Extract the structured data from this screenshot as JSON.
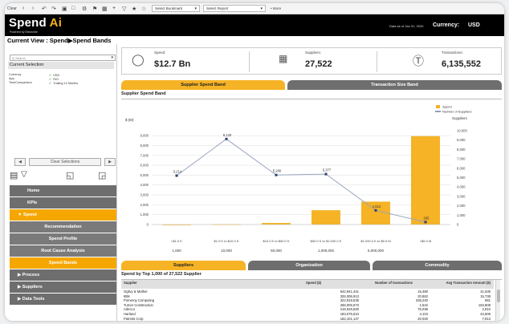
{
  "toolbar": {
    "home_label": "Clear",
    "bookmark_select": "Select Bookmark",
    "report_select": "Select Report",
    "more_label": "• More"
  },
  "header": {
    "brand_main": "Spend ",
    "brand_accent": "Ai",
    "tagline": "Powered by Electrolite",
    "data_date": "Data as of Jan 31, 2020",
    "currency_label": "Currency:",
    "currency_value": "USD"
  },
  "view_title": "Current View : Spend▶Spend Bands",
  "sidebar": {
    "search_placeholder": "Q Search",
    "current_selection_label": "Current Selection",
    "selections": [
      {
        "field": "Currency",
        "value": "USD"
      },
      {
        "field": "App",
        "value": "RIO"
      },
      {
        "field": "TimeComparison",
        "value": "Trailing 12 Months"
      }
    ],
    "clear_label": "Clear Selections",
    "prev_label": "◀",
    "next_label": "▶",
    "nav": [
      {
        "label": "Home"
      },
      {
        "label": "KPIs"
      },
      {
        "label": "▼  Spend"
      },
      {
        "label": "Recommendation"
      },
      {
        "label": "Spend Profile"
      },
      {
        "label": "Root Cause Analysis"
      },
      {
        "label": "Spend Bands"
      },
      {
        "label": "▶  Process"
      },
      {
        "label": "▶  Suppliers"
      },
      {
        "label": "▶  Data Tools"
      }
    ]
  },
  "kpis": [
    {
      "label": "Spend:",
      "value": "$12.7 Bn",
      "icon": "money-icon"
    },
    {
      "label": "Suppliers:",
      "value": "27,522",
      "icon": "supplier-icon"
    },
    {
      "label": "Transactions:",
      "value": "6,135,552",
      "icon": "dollar-circle-icon"
    }
  ],
  "band_tabs": [
    "Supplier Spend Band",
    "Transaction Size Band"
  ],
  "chart_panel_title": "Supplier Spend Band",
  "chart_data": {
    "type": "bar",
    "title": "",
    "categories": [
      "<$1.0 K",
      "$1.0 K to $10.0 K",
      "$10.0 K to $50.0 K",
      "$50.0 K to $1,000.0 K",
      "$1,000.0 K to $5.0 M",
      ">$5.0 M"
    ],
    "x_secondary_labels": [
      "1,000",
      "10,000",
      "50,000",
      "1,000,000",
      "5,000,000",
      ""
    ],
    "ylabel": "$ (M)",
    "y2label": "Suppliers",
    "ylim": [
      0,
      9500
    ],
    "y2lim": [
      0,
      10000
    ],
    "y_ticks": [
      0,
      1000,
      2000,
      3000,
      4000,
      5000,
      6000,
      7000,
      8000,
      9000
    ],
    "y2_ticks": [
      0,
      1000,
      2000,
      3000,
      4000,
      5000,
      6000,
      7000,
      8000,
      9000,
      10000
    ],
    "series": [
      {
        "name": "Spend",
        "type": "bar",
        "color": "#f5b325",
        "values": [
          2,
          28,
          165,
          1450,
          2320,
          8950
        ]
      },
      {
        "name": "Number of Suppliers",
        "type": "line",
        "color": "#2a3f73",
        "values": [
          5214,
          9120,
          5280,
          5377,
          1512,
          265
        ],
        "labels": [
          "5,214",
          "9,120",
          "5,280",
          "5,377",
          "1,512",
          "265"
        ]
      }
    ],
    "legend": "top-right"
  },
  "bottom_tabs": [
    "Suppliers",
    "Organization",
    "Commodity"
  ],
  "table_title": "Spend by Top 1,000 of 27,522 Supplier",
  "table": {
    "columns": [
      "Supplier",
      "Spend ($)",
      "Number of transactions",
      "Avg Transaction Amount ($)"
    ],
    "rows": [
      [
        "Ogilvy & Mather",
        "642,941,441",
        "15,480",
        "41,535"
      ],
      [
        "IBM",
        "328,306,913",
        "20,862",
        "15,738"
      ],
      [
        "Pomeroy Computing",
        "322,918,536",
        "335,240",
        "961"
      ],
      [
        "Turner Construction",
        "266,005,673",
        "1,542",
        "163,808"
      ],
      [
        "Adecco",
        "218,026,830",
        "75,036",
        "2,910"
      ],
      [
        "Harland",
        "183,075,534",
        "4,104",
        "44,606"
      ],
      [
        "Patriots Corp",
        "182,101,147",
        "20,030",
        "7,913"
      ]
    ]
  }
}
